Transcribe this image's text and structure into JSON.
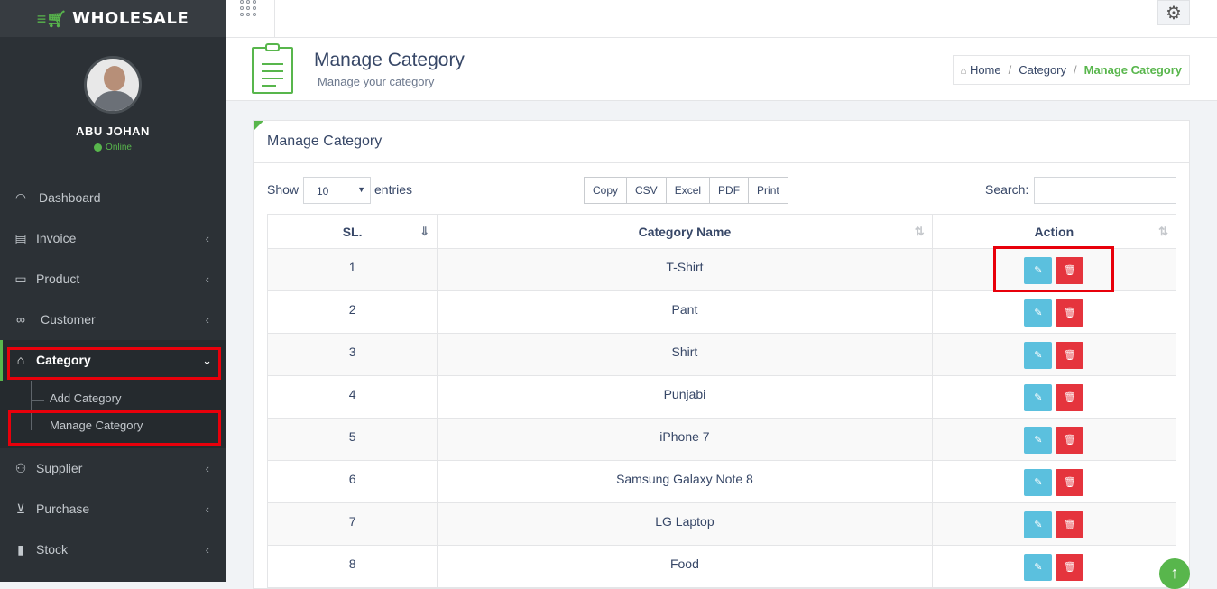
{
  "app": {
    "brand": "WHOLESALE"
  },
  "user": {
    "name": "ABU JOHAN",
    "status": "Online"
  },
  "sidebar": {
    "items": [
      {
        "label": "Dashboard",
        "icon": "dashboard-icon"
      },
      {
        "label": "Invoice",
        "icon": "invoice-icon"
      },
      {
        "label": "Product",
        "icon": "product-icon"
      },
      {
        "label": "Customer",
        "icon": "handshake-icon"
      },
      {
        "label": "Category",
        "icon": "category-icon"
      },
      {
        "label": "Supplier",
        "icon": "user-icon"
      },
      {
        "label": "Purchase",
        "icon": "cart-icon"
      },
      {
        "label": "Stock",
        "icon": "bar-chart-icon"
      }
    ],
    "category_sub": [
      "Add Category",
      "Manage Category"
    ]
  },
  "header": {
    "title": "Manage Category",
    "subtitle": "Manage your category"
  },
  "breadcrumb": {
    "home": "Home",
    "category": "Category",
    "current": "Manage Category"
  },
  "panel": {
    "title": "Manage Category",
    "show": "Show",
    "entries_value": "10",
    "entries": "entries",
    "search_label": "Search:",
    "export_buttons": [
      "Copy",
      "CSV",
      "Excel",
      "PDF",
      "Print"
    ]
  },
  "table": {
    "headers": [
      "SL.",
      "Category Name",
      "Action"
    ],
    "rows": [
      {
        "sl": "1",
        "name": "T-Shirt"
      },
      {
        "sl": "2",
        "name": "Pant"
      },
      {
        "sl": "3",
        "name": "Shirt"
      },
      {
        "sl": "4",
        "name": "Punjabi"
      },
      {
        "sl": "5",
        "name": "iPhone 7"
      },
      {
        "sl": "6",
        "name": "Samsung Galaxy Note 8"
      },
      {
        "sl": "7",
        "name": "LG Laptop"
      },
      {
        "sl": "8",
        "name": "Food"
      }
    ]
  },
  "colors": {
    "accent": "#58b64c",
    "sidebar": "#2c3136",
    "edit": "#5bc0de",
    "delete": "#e5343d",
    "highlight": "#e8000b"
  }
}
